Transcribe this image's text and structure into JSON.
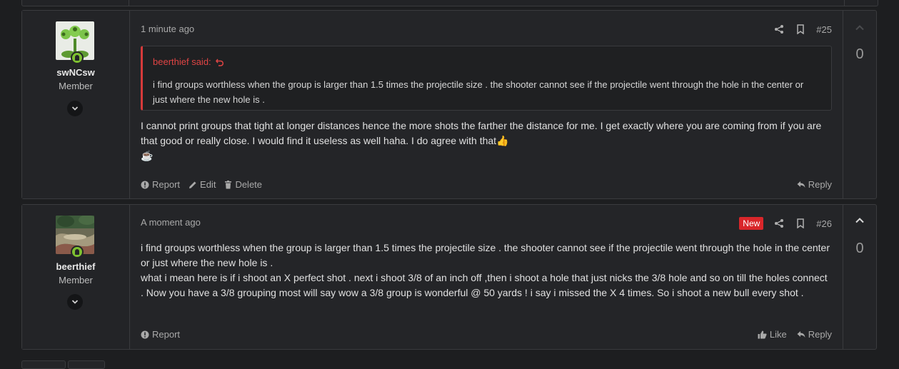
{
  "posts": [
    {
      "username": "swNCsw",
      "user_title": "Member",
      "time": "1 minute ago",
      "number": "#25",
      "new_badge": "",
      "quote": {
        "author": "beerthief said:",
        "text": "i find groups worthless when the group is larger than 1.5 times the projectile size . the shooter cannot see if the projectile went through the hole in the center or just where the new hole is ."
      },
      "message": "I cannot print groups that tight at longer distances hence the more shots the farther the distance for me. I get exactly where you are coming from if you are that good or really close. I would find it useless as well haha. I do agree with that",
      "emoji_thumb": "👍",
      "emoji_coffee": "☕",
      "actions": {
        "report": "Report",
        "edit": "Edit",
        "delete": "Delete",
        "reply": "Reply"
      },
      "score": "0"
    },
    {
      "username": "beerthief",
      "user_title": "Member",
      "time": "A moment ago",
      "number": "#26",
      "new_badge": "New",
      "message_lines": [
        "i find groups worthless when the group is larger than 1.5 times the projectile size . the shooter cannot see if the projectile went through the hole in the center or just where the new hole is .",
        "what i mean here is if i shoot an X perfect shot . next i shoot 3/8 of an inch off ,then i shoot a hole that just nicks the 3/8 hole and so on till the holes connect . Now you have a 3/8 grouping most will say wow a 3/8 group is wonderful @ 50 yards ! i say i missed the X 4 times. So i shoot a new bull every shot ."
      ],
      "actions": {
        "report": "Report",
        "like": "Like",
        "reply": "Reply"
      },
      "score": "0"
    }
  ],
  "colors": {
    "background": "#1d1e20",
    "panel": "#242528",
    "border": "#3a3b3e",
    "quote_accent": "#d63a3a",
    "new_badge": "#d9262a",
    "online": "#7ec131"
  },
  "icons": [
    "share-icon",
    "bookmark-icon",
    "undo-arrow-icon",
    "report-icon",
    "edit-icon",
    "delete-icon",
    "reply-icon",
    "like-icon",
    "chevron-up-icon",
    "chevron-down-icon",
    "user-online-icon"
  ]
}
